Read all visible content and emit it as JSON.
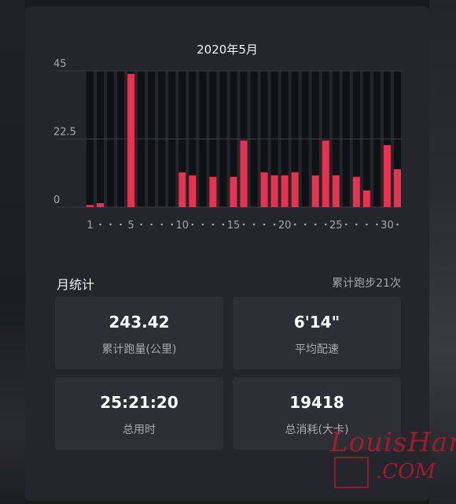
{
  "chart_data": {
    "type": "bar",
    "title": "2020年5月",
    "x": [
      1,
      2,
      3,
      4,
      5,
      6,
      7,
      8,
      9,
      10,
      11,
      12,
      13,
      14,
      15,
      16,
      17,
      18,
      19,
      20,
      21,
      22,
      23,
      24,
      25,
      26,
      27,
      28,
      29,
      30,
      31
    ],
    "values": [
      0.7,
      1.3,
      0,
      0,
      44,
      0,
      0,
      0,
      0,
      11.5,
      10.5,
      0,
      10,
      0,
      10,
      22,
      0,
      11.5,
      10.5,
      10.5,
      11.5,
      0,
      10.5,
      22,
      10.5,
      0,
      10,
      5.5,
      0,
      20.5,
      12.5
    ],
    "ylim": [
      0,
      45
    ],
    "yticks": [
      "45",
      "22.5",
      "0"
    ],
    "xticks": [
      "1",
      "5",
      "10",
      "15",
      "20",
      "25",
      "30"
    ],
    "dot_days": [
      2,
      3,
      4,
      6,
      7,
      8,
      9,
      11,
      12,
      13,
      14,
      16,
      17,
      18,
      19,
      21,
      22,
      23,
      24,
      26,
      27,
      28,
      29,
      31
    ],
    "colors": {
      "bar": "#e8324f",
      "column_bg": "#101114",
      "grid": "#3a3b40",
      "axis_text": "#a6a7ab"
    }
  },
  "summary": {
    "title": "月统计",
    "total_runs": "累计跑步21次"
  },
  "stats": [
    {
      "value": "243.42",
      "label": "累计跑量(公里)"
    },
    {
      "value": "6'14\"",
      "label": "平均配速"
    },
    {
      "value": "25:21:20",
      "label": "总用时"
    },
    {
      "value": "19418",
      "label": "总消耗(大卡)"
    }
  ],
  "watermark": {
    "line1": "LouisHan",
    "line2": ".COM"
  }
}
